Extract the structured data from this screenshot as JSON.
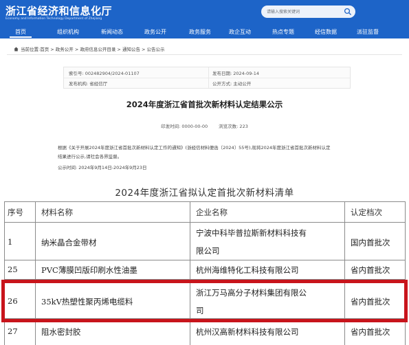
{
  "header": {
    "site_title": "浙江省经济和信息化厅",
    "site_subtitle": "Economy and Information Technology Department of Zhejiang",
    "search_placeholder": "请输入搜索关键词"
  },
  "nav": {
    "items": [
      "首页",
      "组织机构",
      "新闻动态",
      "政务公开",
      "政务服务",
      "政企互动",
      "热点专题",
      "经信数据",
      "派驻监督"
    ],
    "active": "首页"
  },
  "breadcrumb": {
    "prefix": "当前位置:",
    "path": "首页 > 政务公开 > 政府信息公开目录 > 通知公告 > 公告公示"
  },
  "meta": {
    "index_no": "索引号: 002482904/2024-01107",
    "publish_date": "发布日期: 2024-09-14",
    "publisher": "发布机构: 省经信厅",
    "disclosure": "公开方式: 主动公开"
  },
  "doc": {
    "title": "2024年度浙江省首批次新材料认定结果公示",
    "print_time": "印发时间: 0000-00-00",
    "views": "浏览次数: 223",
    "para1_line1": "根据《关于开展2024年度浙江省首批次新材料认定工作的通知》(浙经信材料便函〔2024〕55号),现将2024年度浙江省首批次新材料认定",
    "para1_line2": "结果进行公示,请社会各界监督。",
    "period": "公示时间: 2024年9月14日-2024年9月23日"
  },
  "list": {
    "title": "2024年度浙江省拟认定首批次新材料清单",
    "columns": [
      "序号",
      "材料名称",
      "企业名称",
      "认定档次"
    ],
    "rows": [
      {
        "no": "1",
        "material": "纳米晶合金带材",
        "company_line1": "宁波中科毕普拉斯新材料科技有",
        "company_line2": "限公司",
        "level": "国内首批次"
      },
      {
        "no": "25",
        "material": "PVC薄膜凹版印刷水性油墨",
        "company_line1": "杭州海维特化工科技有限公司",
        "company_line2": "",
        "level": "省内首批次"
      },
      {
        "no": "26",
        "material": "35kV热塑性聚丙烯电缆料",
        "company_line1": "浙江万马高分子材料集团有限公",
        "company_line2": "司",
        "level": "省内首批次"
      },
      {
        "no": "27",
        "material": "阻水密封胶",
        "company_line1": "杭州汉高新材料科技有限公司",
        "company_line2": "",
        "level": "省内首批次"
      }
    ]
  },
  "colors": {
    "brand_blue": "#1d64c8",
    "highlight_red": "#c8141b"
  }
}
